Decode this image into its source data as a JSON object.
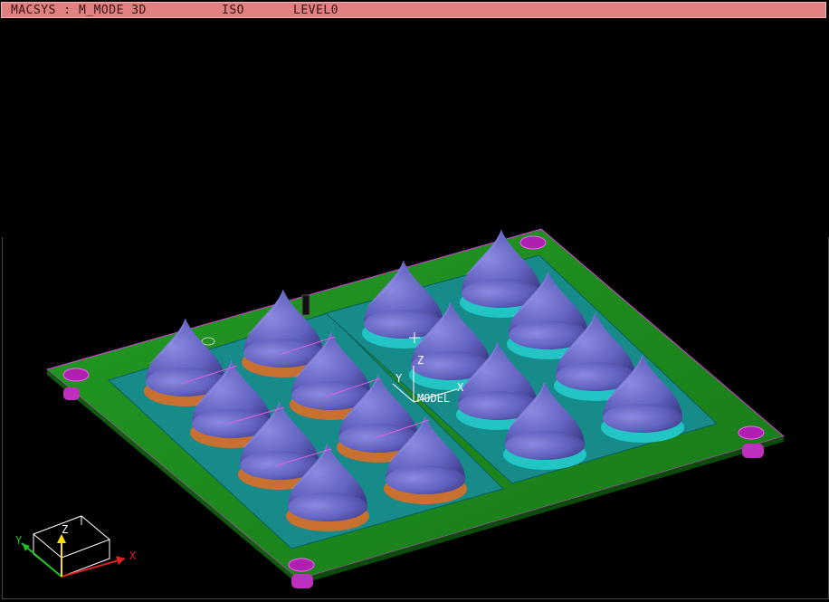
{
  "titlebar": {
    "segments": [
      "MACSYS : M_MODE 3D",
      "ISO",
      "LEVEL0"
    ]
  },
  "model_axis": {
    "z_label": "Z",
    "y_label": "Y",
    "x_label": "X",
    "name_label": "MODEL"
  },
  "triad": {
    "z_label": "Z",
    "y_label": "Y",
    "x_label": "X"
  },
  "colors": {
    "background": "#000000",
    "titlebar": "#e08080",
    "plate": "#1f8a1f",
    "cavity": "#168a8a",
    "cone": "#6a6ac8",
    "cone_ring_left": "#c87030",
    "cone_ring_right": "#20c8c8",
    "holes": "#c030c0"
  },
  "icons": [
    "crosshair-cursor-icon",
    "axis-triad-icon"
  ]
}
